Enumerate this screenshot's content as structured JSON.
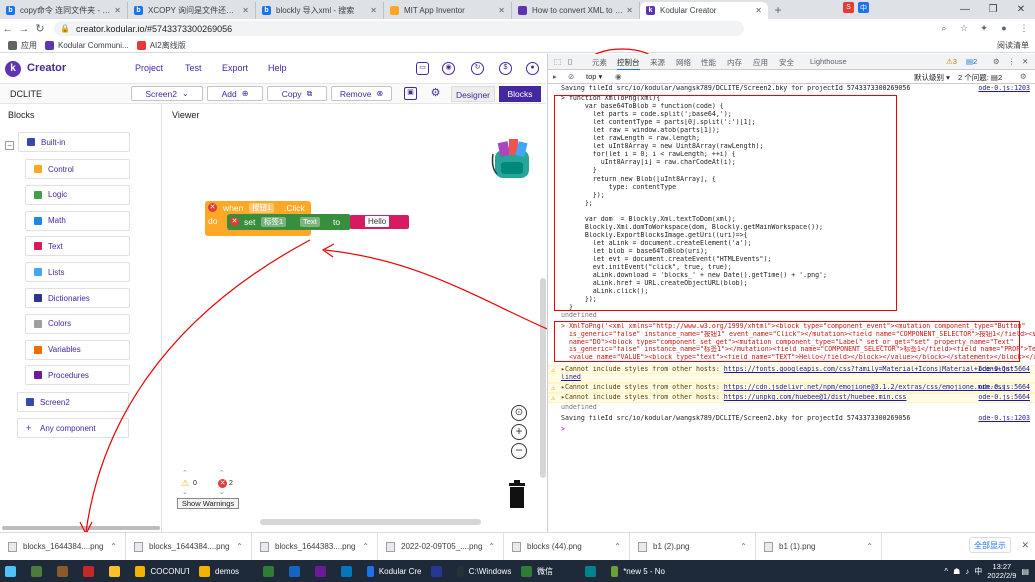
{
  "browser": {
    "tabs": [
      {
        "title": "copy命令 连同文件夹 - 搜索",
        "favicon_color": "#1a73e8",
        "favicon": "b",
        "active": false
      },
      {
        "title": "XCOPY 询问是文件还是文件夹",
        "favicon_color": "#1a73e8",
        "favicon": "b",
        "active": false
      },
      {
        "title": "blockly 导入xml - 搜索",
        "favicon_color": "#1a73e8",
        "favicon": "b",
        "active": false
      },
      {
        "title": "MIT App Inventor",
        "favicon_color": "#f9a825",
        "favicon": "",
        "active": false
      },
      {
        "title": "How to convert XML to png?",
        "favicon_color": "#5e35b1",
        "favicon": "",
        "active": false
      },
      {
        "title": "Kodular Creator",
        "favicon_color": "#5e35b1",
        "favicon": "k",
        "active": true
      }
    ],
    "new_tab_label": "+",
    "url": "creator.kodular.io/#5743373300269056",
    "bookmarks": [
      {
        "label": "应用",
        "color": "#5f6368"
      },
      {
        "label": "Kodular Communi...",
        "color": "#5e35b1"
      },
      {
        "label": "AI2离线版",
        "color": "#e53935"
      }
    ],
    "reading_list": "阅读清单"
  },
  "app": {
    "brand": "Creator",
    "menu": [
      "Project",
      "Test",
      "Export",
      "Help"
    ],
    "project_name": "DCLITE",
    "toolbar": {
      "screen": "Screen2",
      "add": "Add",
      "copy": "Copy",
      "remove": "Remove",
      "designer": "Designer",
      "blocks": "Blocks"
    },
    "blocks_title": "Blocks",
    "viewer_title": "Viewer",
    "builtin": "Built-in",
    "builtin_items": [
      {
        "label": "Control",
        "color": "#f9a825"
      },
      {
        "label": "Logic",
        "color": "#43a047"
      },
      {
        "label": "Math",
        "color": "#1e88e5"
      },
      {
        "label": "Text",
        "color": "#d81b60"
      },
      {
        "label": "Lists",
        "color": "#42a5f5"
      },
      {
        "label": "Dictionaries",
        "color": "#283593"
      },
      {
        "label": "Colors",
        "color": "#9e9e9e"
      },
      {
        "label": "Variables",
        "color": "#ef6c00"
      },
      {
        "label": "Procedures",
        "color": "#6a1b9a"
      }
    ],
    "screen2": "Screen2",
    "any_component": "Any component",
    "blocks": {
      "when": "when",
      "button": "按钮1",
      "click": ".Click",
      "do": "do",
      "set": "set",
      "label": "标签1",
      "text_prop": "Text",
      "to": "to",
      "hello": "Hello"
    },
    "warning_count": "0",
    "error_count": "2",
    "show_warnings": "Show Warnings"
  },
  "devtools": {
    "tabs": [
      "元素",
      "控制台",
      "来源",
      "网络",
      "性能",
      "内存",
      "应用",
      "安全",
      "Lighthouse"
    ],
    "warning_badge": "3",
    "info_badge": "2",
    "context": "top",
    "level": "默认级别",
    "issues": "2 个问题:",
    "issues_badge": "2",
    "console_lines": [
      {
        "text": "Saving fileId src/io/kodular/wangsk789/DCLITE/Screen2.bky for projectId 5743373300269056",
        "src": "ode-0.js:1203",
        "type": "log"
      },
      {
        "text": "> function XmlToPng(xml){",
        "type": "code"
      },
      {
        "text": "      var base64ToBlob = function(code) {",
        "type": "code"
      },
      {
        "text": "        let parts = code.split(';base64,');",
        "type": "code"
      },
      {
        "text": "        let contentType = parts[0].split(':')[1];",
        "type": "code"
      },
      {
        "text": "        let raw = window.atob(parts[1]);",
        "type": "code"
      },
      {
        "text": "        let rawLength = raw.length;",
        "type": "code"
      },
      {
        "text": "        let uInt8Array = new Uint8Array(rawLength);",
        "type": "code"
      },
      {
        "text": "        for(let i = 0; i < rawLength; ++i) {",
        "type": "code"
      },
      {
        "text": "          uInt8Array[i] = raw.charCodeAt(i);",
        "type": "code"
      },
      {
        "text": "        }",
        "type": "code"
      },
      {
        "text": "        return new Blob([uInt8Array], {",
        "type": "code"
      },
      {
        "text": "            type: contentType",
        "type": "code"
      },
      {
        "text": "        });",
        "type": "code"
      },
      {
        "text": "      };",
        "type": "code"
      },
      {
        "text": "",
        "type": "code"
      },
      {
        "text": "      var dom  = Blockly.Xml.textToDom(xml);",
        "type": "code"
      },
      {
        "text": "      Blockly.Xml.domToWorkspace(dom, Blockly.getMainWorkspace());",
        "type": "code"
      },
      {
        "text": "      Blockly.ExportBlocksImage.getUri((uri)=>{",
        "type": "code"
      },
      {
        "text": "        let aLink = document.createElement('a');",
        "type": "code"
      },
      {
        "text": "        let blob = base64ToBlob(uri);",
        "type": "code"
      },
      {
        "text": "        let evt = document.createEvent(\"HTMLEvents\");",
        "type": "code"
      },
      {
        "text": "        evt.initEvent(\"click\", true, true);",
        "type": "code"
      },
      {
        "text": "        aLink.download = 'blocks_' + new Date().getTime() + '.png';",
        "type": "code"
      },
      {
        "text": "        aLink.href = URL.createObjectURL(blob);",
        "type": "code"
      },
      {
        "text": "        aLink.click();",
        "type": "code"
      },
      {
        "text": "      });",
        "type": "code"
      },
      {
        "text": "  }",
        "type": "code"
      },
      {
        "text": "undefined",
        "type": "result"
      }
    ],
    "xml_call": [
      "> XmlToPng('<xml xmlns=\"http://www.w3.org/1999/xhtml\"><block type=\"component_event\"><mutation component_type=\"Button\"",
      "  is_generic=\"false\" instance_name=\"按钮1\" event_name=\"Click\"></mutation><field name=\"COMPONENT_SELECTOR\">按钮1</field><statement",
      "  name=\"DO\"><block type=\"component_set_get\"><mutation component_type=\"Label\" set_or_get=\"set\" property_name=\"Text\"",
      "  is_generic=\"false\" instance_name=\"标签1\"></mutation><field name=\"COMPONENT_SELECTOR\">标签1</field><field name=\"PROP\">Text</field>",
      "  <value name=\"VALUE\"><block type=\"text\"><field name=\"TEXT\">Hello</field></block></value></block></statement></block></xml>')"
    ],
    "warnings": [
      {
        "pre": "▸Cannot include styles from other hosts: ",
        "link": "https://fonts.googleapis.com/css?family=Material+Icons|Material+Icons+Out",
        "cont": "lined",
        "src": "ode-0.js:5664"
      },
      {
        "pre": "▸Cannot include styles from other hosts: ",
        "link": "https://cdn.jsdelivr.net/npm/emojione@3.1.2/extras/css/emojione.min.css",
        "cont": "",
        "src": "ode-0.js:5664"
      },
      {
        "pre": "▸Cannot include styles from other hosts: ",
        "link": "https://unpkg.com/huebee@1/dist/huebee.min.css",
        "cont": "",
        "src": "ode-0.js:5664"
      }
    ],
    "after": [
      {
        "text": "undefined",
        "type": "result"
      },
      {
        "text": "Saving fileId src/io/kodular/wangsk789/DCLITE/Screen2.bky for projectId 5743373300269056",
        "src": "ode-0.js:1203",
        "type": "log"
      },
      {
        "text": ">",
        "type": "prompt"
      }
    ]
  },
  "downloads": {
    "items": [
      "blocks_1644384....png",
      "blocks_1644384....png",
      "blocks_1644383....png",
      "2022-02-09T05_....png",
      "blocks (44).png",
      "b1 (2).png",
      "b1 (1).png"
    ],
    "show_all": "全部显示"
  },
  "taskbar": {
    "items": [
      {
        "label": "",
        "color": "#4e7a3a"
      },
      {
        "label": "",
        "color": "#8b5a2b"
      },
      {
        "label": "",
        "color": "#c62828"
      },
      {
        "label": "",
        "color": "#fbc02d"
      },
      {
        "label": "COCONUT",
        "color": "#f2b400"
      },
      {
        "label": "demos",
        "color": "#f2b400"
      },
      {
        "label": "",
        "color": "#2e7d32"
      },
      {
        "label": "",
        "color": "#1565c0"
      },
      {
        "label": "",
        "color": "#6a1b9a"
      },
      {
        "label": "",
        "color": "#0277bd"
      },
      {
        "label": "Kodular Creator -...",
        "color": "#1a73e8"
      },
      {
        "label": "",
        "color": "#283593"
      },
      {
        "label": "C:\\Windows\\syste...",
        "color": "#263238"
      },
      {
        "label": "微信",
        "color": "#2e7d32"
      },
      {
        "label": "",
        "color": "#00838f"
      },
      {
        "label": "*new 5 - Notepa...",
        "color": "#689f38"
      }
    ],
    "time": "13:27",
    "date": "2022/2/9"
  }
}
